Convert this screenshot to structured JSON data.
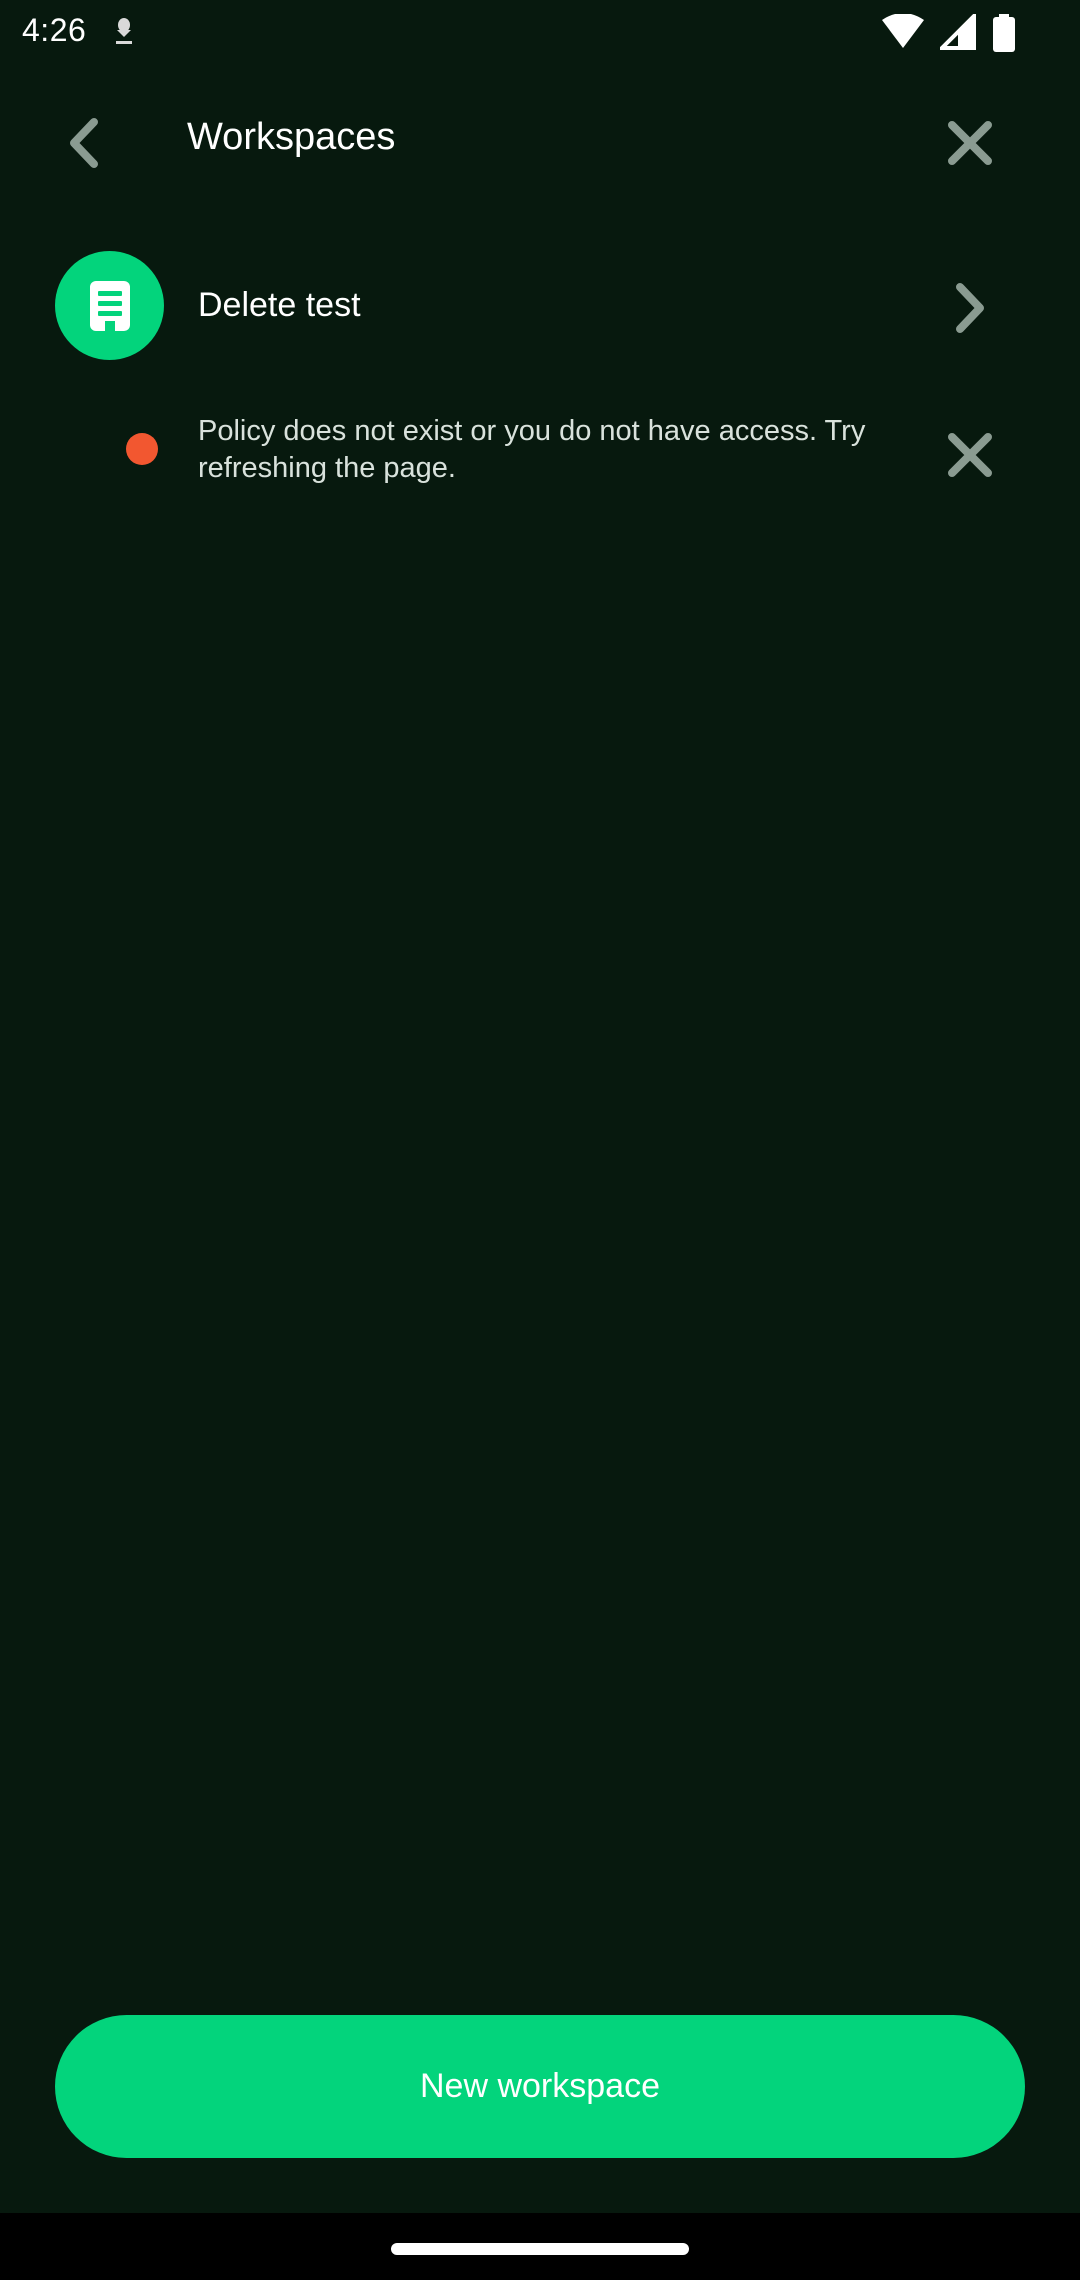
{
  "status_bar": {
    "time": "4:26",
    "icons": [
      "download-icon",
      "wifi-icon",
      "cellular-signal-icon",
      "battery-icon"
    ]
  },
  "header": {
    "title": "Workspaces",
    "back_icon": "chevron-left-icon",
    "close_icon": "close-icon"
  },
  "workspace": {
    "name": "Delete test",
    "avatar_icon": "building-icon",
    "chevron_icon": "chevron-right-icon"
  },
  "error": {
    "message": "Policy does not exist or you do not have access. Try refreshing the page.",
    "dot_color": "#f25730",
    "dismiss_icon": "close-icon"
  },
  "footer": {
    "new_workspace_label": "New workspace"
  },
  "colors": {
    "background": "#07190e",
    "accent": "#03d47c",
    "icon": "#8a9b91",
    "text": "#ffffff"
  }
}
